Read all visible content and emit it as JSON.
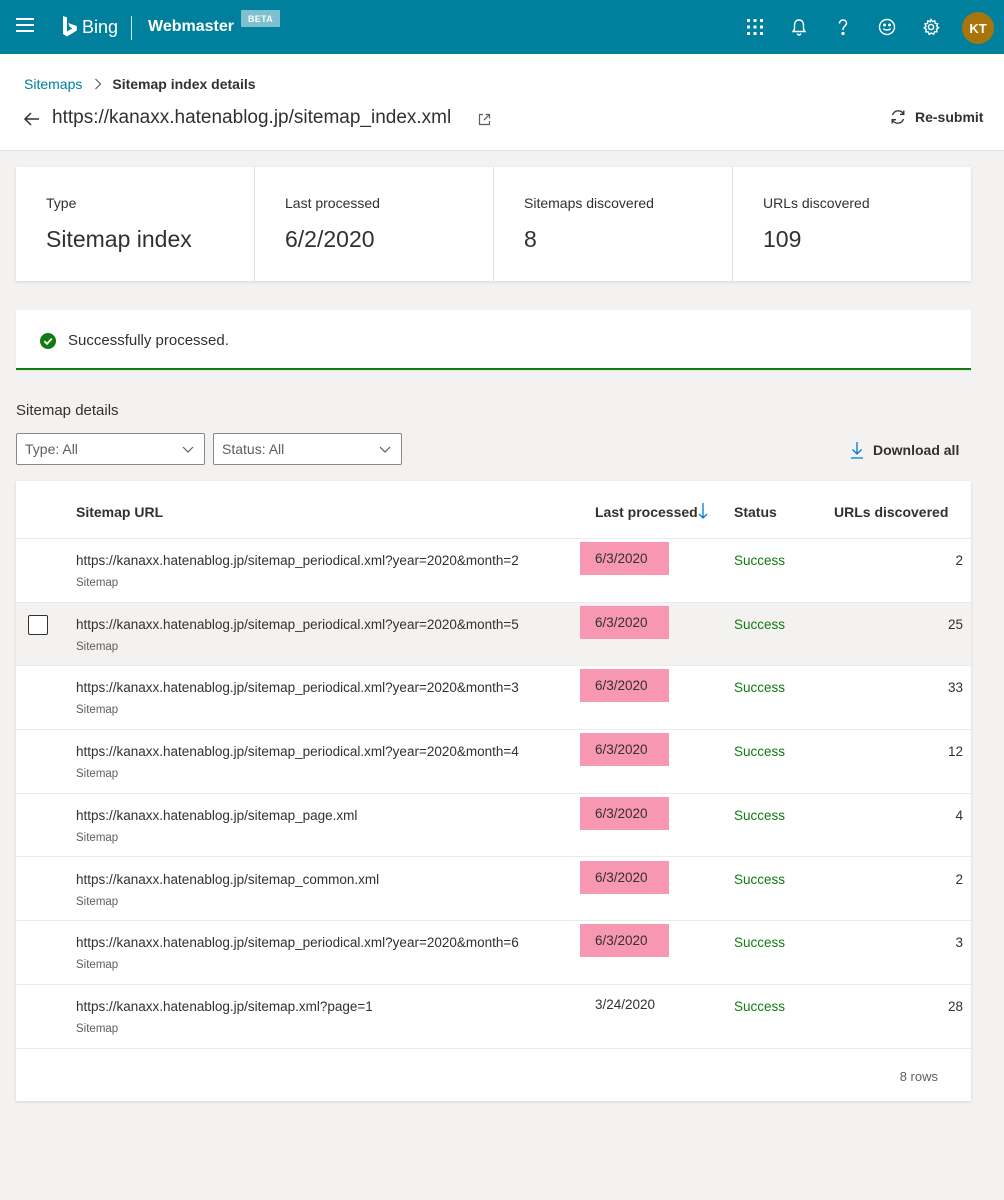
{
  "topbar": {
    "brand": "Bing",
    "product": "Webmaster",
    "badge": "BETA",
    "avatar_initials": "KT",
    "icons": [
      "menu-icon",
      "bing-logo-icon",
      "apps-grid-icon",
      "bell-icon",
      "help-icon",
      "feedback-smiley-icon",
      "gear-icon"
    ],
    "color": "#00809d"
  },
  "breadcrumb": {
    "parent": "Sitemaps",
    "current": "Sitemap index details"
  },
  "header": {
    "title": "https://kanaxx.hatenablog.jp/sitemap_index.xml",
    "resubmit_label": "Re-submit"
  },
  "stats": [
    {
      "label": "Type",
      "value": "Sitemap index"
    },
    {
      "label": "Last processed",
      "value": "6/2/2020"
    },
    {
      "label": "Sitemaps discovered",
      "value": "8"
    },
    {
      "label": "URLs discovered",
      "value": "109"
    }
  ],
  "banner": {
    "message": "Successfully processed.",
    "color": "#107c10"
  },
  "details": {
    "title": "Sitemap details",
    "type_filter": "Type: All",
    "status_filter": "Status: All",
    "download_label": "Download all"
  },
  "table": {
    "columns": {
      "url": "Sitemap URL",
      "last_processed": "Last processed",
      "status": "Status",
      "urls": "URLs discovered"
    },
    "rows": [
      {
        "url": "https://kanaxx.hatenablog.jp/sitemap_periodical.xml?year=2020&month=2",
        "type": "Sitemap",
        "date": "6/3/2020",
        "status": "Success",
        "count": "2"
      },
      {
        "url": "https://kanaxx.hatenablog.jp/sitemap_periodical.xml?year=2020&month=5",
        "type": "Sitemap",
        "date": "6/3/2020",
        "status": "Success",
        "count": "25"
      },
      {
        "url": "https://kanaxx.hatenablog.jp/sitemap_periodical.xml?year=2020&month=3",
        "type": "Sitemap",
        "date": "6/3/2020",
        "status": "Success",
        "count": "33"
      },
      {
        "url": "https://kanaxx.hatenablog.jp/sitemap_periodical.xml?year=2020&month=4",
        "type": "Sitemap",
        "date": "6/3/2020",
        "status": "Success",
        "count": "12"
      },
      {
        "url": "https://kanaxx.hatenablog.jp/sitemap_page.xml",
        "type": "Sitemap",
        "date": "6/3/2020",
        "status": "Success",
        "count": "4"
      },
      {
        "url": "https://kanaxx.hatenablog.jp/sitemap_common.xml",
        "type": "Sitemap",
        "date": "6/3/2020",
        "status": "Success",
        "count": "2"
      },
      {
        "url": "https://kanaxx.hatenablog.jp/sitemap_periodical.xml?year=2020&month=6",
        "type": "Sitemap",
        "date": "6/3/2020",
        "status": "Success",
        "count": "3"
      },
      {
        "url": "https://kanaxx.hatenablog.jp/sitemap.xml?page=1",
        "type": "Sitemap",
        "date": "3/24/2020",
        "status": "Success",
        "count": "28"
      }
    ],
    "footer": "8 rows",
    "highlight_color": "#f797b2"
  }
}
